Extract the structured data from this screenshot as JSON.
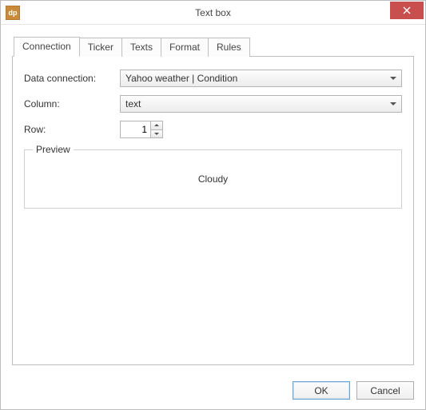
{
  "window": {
    "title": "Text box",
    "app_icon_text": "dp"
  },
  "tabs": [
    {
      "label": "Connection",
      "active": true
    },
    {
      "label": "Ticker",
      "active": false
    },
    {
      "label": "Texts",
      "active": false
    },
    {
      "label": "Format",
      "active": false
    },
    {
      "label": "Rules",
      "active": false
    }
  ],
  "form": {
    "data_connection_label": "Data connection:",
    "data_connection_value": "Yahoo weather | Condition",
    "column_label": "Column:",
    "column_value": "text",
    "row_label": "Row:",
    "row_value": "1"
  },
  "preview": {
    "legend": "Preview",
    "value": "Cloudy"
  },
  "buttons": {
    "ok": "OK",
    "cancel": "Cancel"
  }
}
